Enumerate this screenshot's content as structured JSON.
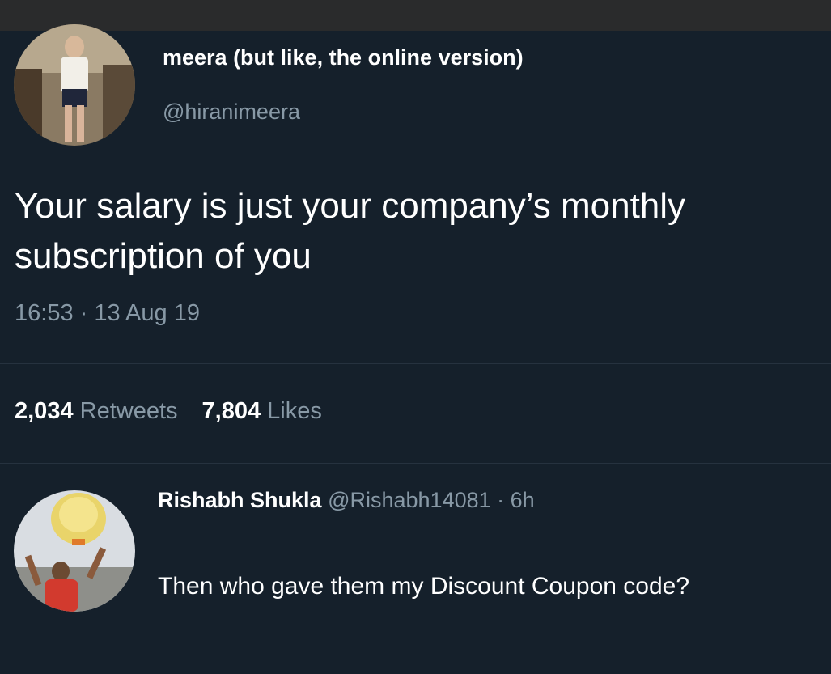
{
  "tweet": {
    "author": {
      "display_name": "meera (but like, the online version)",
      "handle": "@hiranimeera",
      "avatar": "user-avatar-photo"
    },
    "text_lines": [
      "Your salary is just your company’s monthly",
      "subscription of you"
    ],
    "timestamp": "16:53 · 13 Aug 19",
    "retweets": {
      "count": "2,034",
      "label": "Retweets"
    },
    "likes": {
      "count": "7,804",
      "label": "Likes"
    }
  },
  "reply": {
    "display_name": "Rishabh Shukla",
    "handle": "@Rishabh14081",
    "separator": "·",
    "time": "6h",
    "text": "Then who gave them my Discount Coupon code?",
    "avatar": "user-avatar-photo"
  },
  "colors": {
    "background": "#15202b",
    "text_primary": "#ffffff",
    "text_secondary": "#8899a6",
    "divider": "#26323f"
  }
}
